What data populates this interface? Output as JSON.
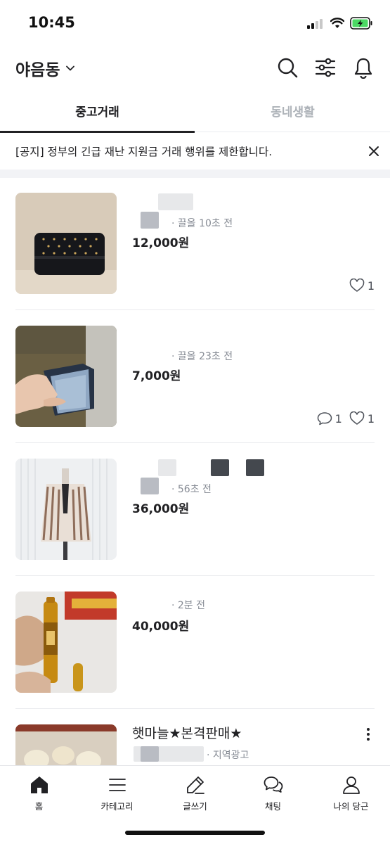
{
  "status_bar": {
    "time": "10:45",
    "battery_color": "#4cd964"
  },
  "header": {
    "location": "야음동",
    "icons": [
      "chevron-down-icon",
      "search-icon",
      "filter-icon",
      "bell-icon"
    ]
  },
  "tabs": [
    {
      "label": "중고거래",
      "active": true
    },
    {
      "label": "동네생활",
      "active": false
    }
  ],
  "notice": {
    "text": "[공지] 정부의 긴급 재난 지원금 거래 행위를 제한합니다."
  },
  "listings": [
    {
      "meta": "· 끌올 10초 전",
      "price": "12,000원",
      "likes": "1"
    },
    {
      "meta": "· 끌올 23초 전",
      "price": "7,000원",
      "comments": "1",
      "likes": "1"
    },
    {
      "meta": "· 56초 전",
      "price": "36,000원"
    },
    {
      "meta": "· 2분 전",
      "price": "40,000원"
    }
  ],
  "ad": {
    "title": "햇마늘★본격판매★",
    "meta": "· 지역광고"
  },
  "bottom_nav": [
    {
      "label": "홈",
      "icon": "home-icon",
      "active": true
    },
    {
      "label": "카테고리",
      "icon": "menu-icon"
    },
    {
      "label": "글쓰기",
      "icon": "pencil-icon"
    },
    {
      "label": "채팅",
      "icon": "chat-icon"
    },
    {
      "label": "나의 당근",
      "icon": "user-icon"
    }
  ],
  "colors": {
    "accent": "#212124",
    "muted": "#868b94",
    "inactive_tab": "#aeb3b9"
  }
}
